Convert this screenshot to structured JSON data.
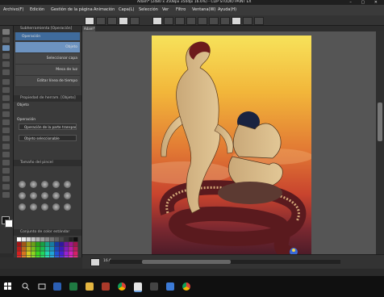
{
  "window": {
    "title": "Adam* (2480 x 3508px 350dpi 16.6%) - CLIP STUDIO PAINT EX"
  },
  "menu": {
    "items": [
      {
        "label": "Archivo(F)"
      },
      {
        "label": "Edición"
      },
      {
        "label": "Gestión de la página"
      },
      {
        "label": "Animación"
      },
      {
        "label": "Capa(L)"
      },
      {
        "label": "Selección"
      },
      {
        "label": "Ver"
      },
      {
        "label": "Filtro"
      },
      {
        "label": "Ventana(W)"
      },
      {
        "label": "Ayuda(H)"
      }
    ]
  },
  "sub_tool": {
    "title": "Subherramienta [Operación]",
    "selected": "Operación",
    "items": [
      {
        "label": "Objeto"
      },
      {
        "label": "Seleccionar capa"
      },
      {
        "label": "Mesa de luz"
      },
      {
        "label": "Editar línea de tiempo"
      }
    ]
  },
  "tool_property": {
    "title": "Propiedad de herram. [Objeto]",
    "header": "Objeto",
    "section_label": "Operación",
    "operation_value": "Operación de la parte transparente",
    "object_value": "Objeto seleccionable"
  },
  "brush_size": {
    "title": "Tamaño del pincel"
  },
  "color_set": {
    "title": "Conjunto de color estándar"
  },
  "document": {
    "tab": "Adam*"
  },
  "status": {
    "zoom": "16.6"
  },
  "colors": {
    "panel_bg": "#3a3a3a",
    "selected_blue": "#3f6b9c",
    "canvas_bg": "#555555",
    "taskbar": "#101010"
  },
  "taskbar": {
    "icons": [
      "windows-start-icon",
      "search-icon",
      "task-view-icon",
      "word-icon",
      "excel-icon",
      "file-explorer-icon",
      "chrome-icon",
      "clip-studio-icon",
      "store-icon",
      "photos-icon",
      "chrome-icon-2"
    ]
  }
}
